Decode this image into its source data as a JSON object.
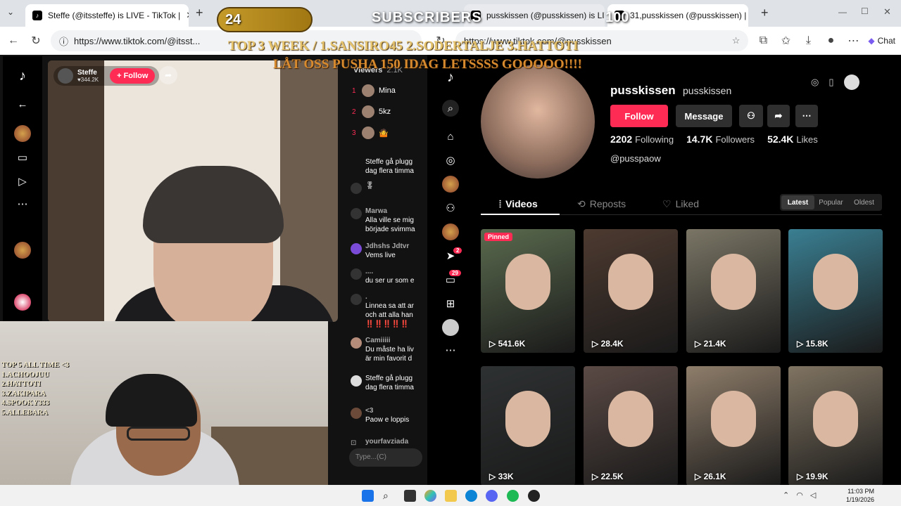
{
  "left_browser": {
    "tab_title": "Steffe (@itssteffe) is LIVE - TikTok |",
    "url": "https://www.tiktok.com/@itsst..."
  },
  "live": {
    "streamer_name": "Steffe",
    "streamer_likes": "344.2K",
    "follow_label": "+ Follow"
  },
  "viewers": {
    "label": "Viewers",
    "count": "2.1K",
    "list": [
      {
        "rank": "1",
        "name": "Mina"
      },
      {
        "rank": "2",
        "name": "5kz"
      },
      {
        "rank": "3",
        "name": "🤷"
      }
    ]
  },
  "chat": {
    "messages": [
      {
        "name": "",
        "text": "Steffe gå plugg"
      },
      {
        "name": "",
        "text": "dag flera timma"
      },
      {
        "name": "🎖",
        "text": ""
      },
      {
        "name": "Marwa",
        "text": "Alla ville se mig"
      },
      {
        "name": "",
        "text": "började svimma"
      },
      {
        "name": "Jdhshs Jdtvr",
        "text": "Vems live"
      },
      {
        "name": "....",
        "text": "du ser ur som e"
      },
      {
        "name": ".",
        "text": "Linnea sa att ar"
      },
      {
        "name": "",
        "text": "och att alla han"
      },
      {
        "name": "",
        "text": "‼️‼️‼️‼️‼️"
      },
      {
        "name": "Camiiiii",
        "text": "Du måste ha liv"
      },
      {
        "name": "",
        "text": "är min favorit d"
      },
      {
        "name": "",
        "text": "Steffe gå plugg"
      },
      {
        "name": "",
        "text": "dag flera timma"
      },
      {
        "name": "<3",
        "text": "Paow e loppis"
      },
      {
        "name": "yourfavziada",
        "text": ""
      }
    ],
    "input_placeholder": "Type...(C)"
  },
  "webcam": {
    "alltime_title": "TOP 5 ALL TIME <3",
    "alltime": [
      "1.ACHOOJUU",
      "2.HATTOTI",
      "3.ZAKIPARA",
      "4.SPOOKY333",
      "5.ALLEBARA"
    ]
  },
  "overlay": {
    "sub_current": "24",
    "sub_label": "SUBSCRIBERS",
    "sub_goal": "100",
    "top3_week": "TOP 3 WEEK / 1.SANSIRO45 2.SODERTALJE 3.HATTOTI",
    "lat_oss": "LÅT OSS PUSHA 150 IDAG LETSSSS GOOOOO!!!!"
  },
  "right_browser": {
    "tab1_title": "pusskissen (@pusskissen) is LIV",
    "tab2_title": "31,pusskissen (@pusskissen) |",
    "url": "https://www.tiktok.com/@pusskissen",
    "chat_label": "Chat"
  },
  "profile": {
    "display_name": "pusskissen",
    "username": "pusskissen",
    "follow_label": "Follow",
    "message_label": "Message",
    "following": "2202",
    "following_label": "Following",
    "followers": "14.7K",
    "followers_label": "Followers",
    "likes": "52.4K",
    "likes_label": "Likes",
    "bio": "@pusspaow",
    "tabs": [
      "Videos",
      "Reposts",
      "Liked"
    ],
    "sort": [
      "Latest",
      "Popular",
      "Oldest"
    ],
    "pinned_label": "Pinned",
    "videos": [
      {
        "views": "541.6K",
        "color": "#5a6a4e"
      },
      {
        "views": "28.4K",
        "color": "#4d3a30"
      },
      {
        "views": "21.4K",
        "color": "#7a7565"
      },
      {
        "views": "15.8K",
        "color": "#3a7f92"
      },
      {
        "views": "33K",
        "color": "#2e3132"
      },
      {
        "views": "22.5K",
        "color": "#5b4a45"
      },
      {
        "views": "26.1K",
        "color": "#8e7d6a"
      },
      {
        "views": "19.9K",
        "color": "#807462"
      }
    ]
  },
  "side_badges": {
    "messages": "2",
    "inbox": "29"
  },
  "clock": {
    "time": "11:03 PM",
    "date": "1/19/2026"
  },
  "colors": {
    "accent": "#fe2c55"
  }
}
